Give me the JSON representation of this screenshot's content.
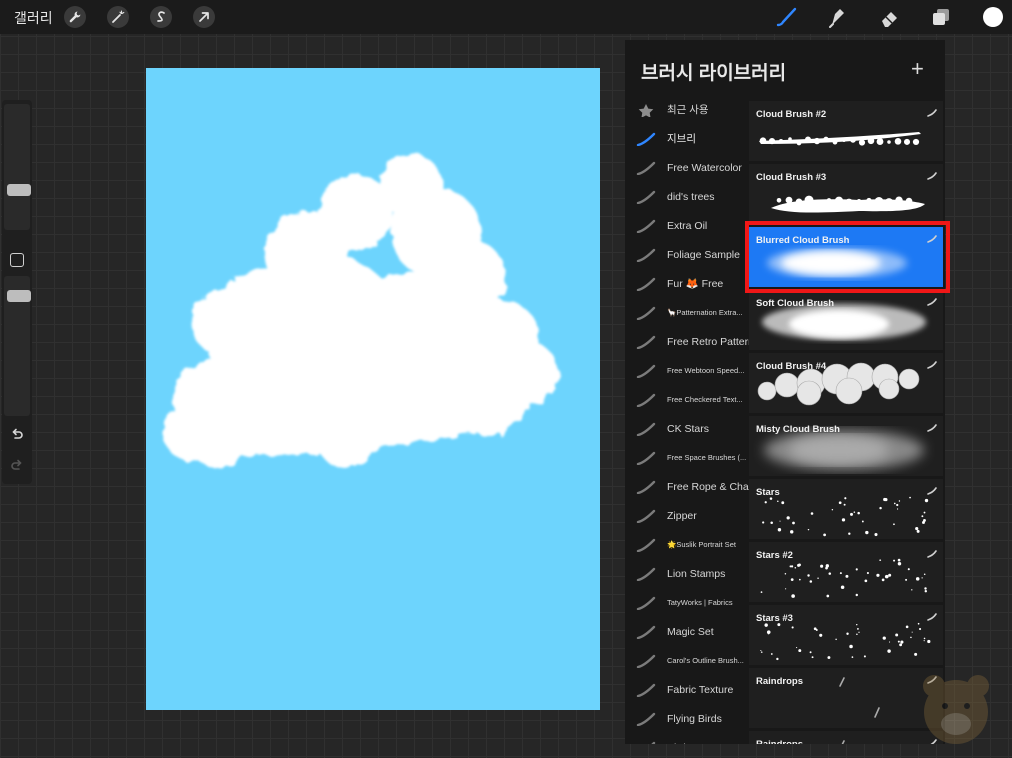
{
  "topbar": {
    "gallery_label": "갤러리",
    "left_tools": [
      "wrench-icon",
      "magic-wand-icon",
      "selection-icon",
      "move-arrow-icon"
    ],
    "right_tools": [
      "brush-icon",
      "smudge-icon",
      "eraser-icon",
      "layers-icon"
    ],
    "current_color": "#ffffff"
  },
  "panel": {
    "title": "브러시 라이브러리",
    "add_label": "+",
    "sets": [
      {
        "label": "최근 사용",
        "icon": "star-icon"
      },
      {
        "label": "지브리",
        "icon": "brush-set-icon",
        "active": true
      },
      {
        "label": "Free Watercolor",
        "icon": "brush-set-icon"
      },
      {
        "label": "did's trees",
        "icon": "brush-set-icon"
      },
      {
        "label": "Extra Oil",
        "icon": "brush-set-icon"
      },
      {
        "label": "Foliage Sample",
        "icon": "brush-set-icon"
      },
      {
        "label": "Fur 🦊 Free",
        "icon": "brush-set-icon"
      },
      {
        "label": "🦙Patternation Extra...",
        "icon": "brush-set-icon",
        "small": true
      },
      {
        "label": "Free Retro Pattern",
        "icon": "brush-set-icon"
      },
      {
        "label": "Free Webtoon Speed...",
        "icon": "brush-set-icon",
        "small": true
      },
      {
        "label": "Free Checkered Text...",
        "icon": "brush-set-icon",
        "small": true
      },
      {
        "label": "CK Stars",
        "icon": "brush-set-icon"
      },
      {
        "label": "Free Space Brushes (...",
        "icon": "brush-set-icon",
        "small": true
      },
      {
        "label": "Free Rope & Chain",
        "icon": "brush-set-icon"
      },
      {
        "label": "Zipper",
        "icon": "brush-set-icon"
      },
      {
        "label": "🌟Suslik Portrait Set",
        "icon": "brush-set-icon",
        "small": true
      },
      {
        "label": "Lion Stamps",
        "icon": "brush-set-icon"
      },
      {
        "label": "TatyWorks | Fabrics",
        "icon": "brush-set-icon",
        "small": true
      },
      {
        "label": "Magic Set",
        "icon": "brush-set-icon"
      },
      {
        "label": "Carol's Outline Brush...",
        "icon": "brush-set-icon",
        "small": true
      },
      {
        "label": "Fabric Texture",
        "icon": "brush-set-icon"
      },
      {
        "label": "Flying Birds",
        "icon": "brush-set-icon"
      },
      {
        "label": "Bird",
        "icon": "brush-set-icon"
      }
    ],
    "brushes": [
      {
        "name": "Cloud Brush #2",
        "stroke": "cloud-thin"
      },
      {
        "name": "Cloud Brush #3",
        "stroke": "cloud-flat"
      },
      {
        "name": "Blurred Cloud Brush",
        "stroke": "cloud-blur",
        "selected": true
      },
      {
        "name": "Soft Cloud Brush",
        "stroke": "cloud-soft"
      },
      {
        "name": "Cloud Brush #4",
        "stroke": "cloud-puffy"
      },
      {
        "name": "Misty Cloud Brush",
        "stroke": "mist"
      },
      {
        "name": "Stars",
        "stroke": "stars"
      },
      {
        "name": "Stars #2",
        "stroke": "stars"
      },
      {
        "name": "Stars #3",
        "stroke": "stars"
      },
      {
        "name": "Raindrops",
        "stroke": "rain"
      },
      {
        "name": "Raindrops",
        "stroke": "rain"
      }
    ]
  },
  "canvas": {
    "background": "#6dd4fd"
  },
  "colors": {
    "selected": "#1d79f4",
    "highlight": "#f01717",
    "active_set_icon": "#2f86ff"
  }
}
